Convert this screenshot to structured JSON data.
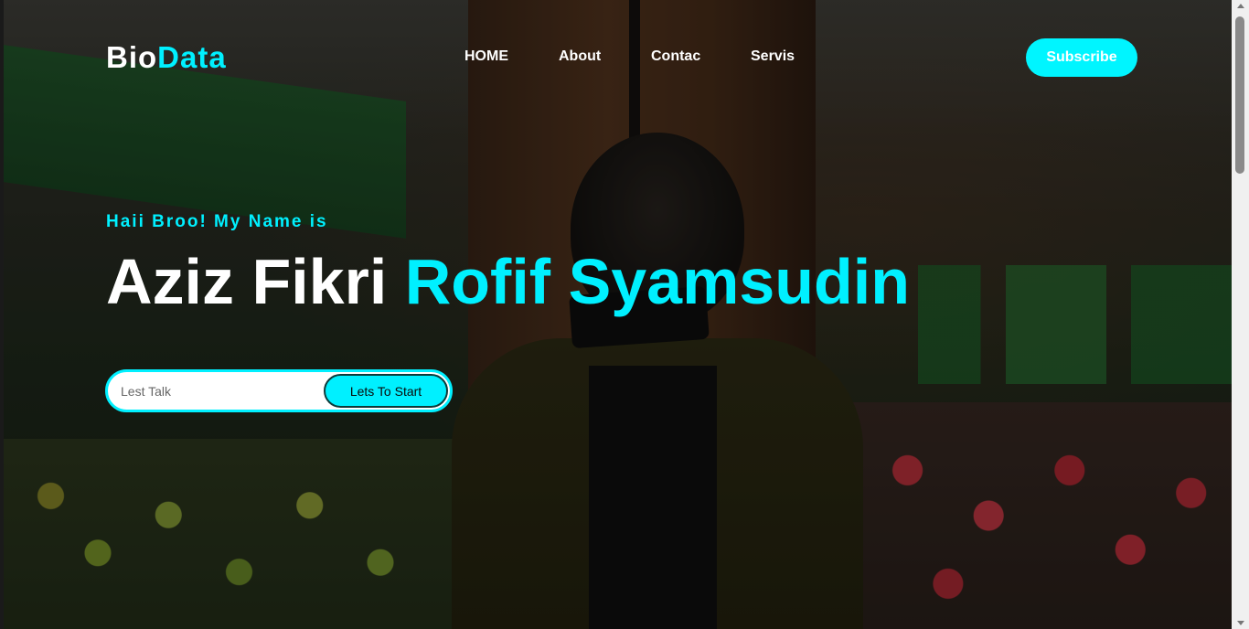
{
  "brand": {
    "part1": "Bio",
    "part2": "Data"
  },
  "nav": {
    "home": "HOME",
    "about": "About",
    "contac": "Contac",
    "servis": "Servis",
    "subscribe": "Subscribe"
  },
  "hero": {
    "greeting": "Haii Broo! My Name is",
    "name_first": "Aziz Fikri ",
    "name_last": "Rofif Syamsudin"
  },
  "cta": {
    "placeholder": "Lest Talk",
    "button": "Lets To Start"
  },
  "colors": {
    "accent": "#00f0ff",
    "text": "#ffffff"
  }
}
